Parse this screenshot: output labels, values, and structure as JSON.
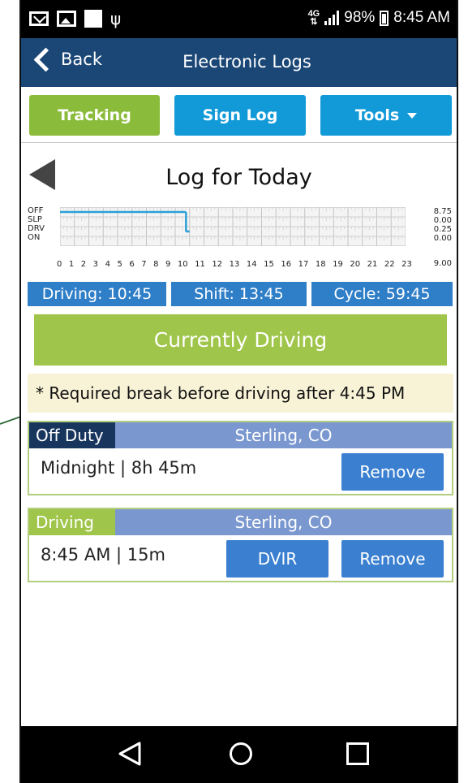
{
  "status_bar": {
    "network": "4G",
    "battery": "98%",
    "time": "8:45 AM"
  },
  "title_bar": {
    "back_label": "Back",
    "title": "Electronic Logs"
  },
  "toolbar": {
    "tracking_label": "Tracking",
    "sign_log_label": "Sign Log",
    "tools_label": "Tools"
  },
  "log": {
    "title": "Log for Today",
    "row_labels": [
      "OFF",
      "SLP",
      "DRV",
      "ON"
    ],
    "row_totals": [
      "8.75",
      "0.00",
      "0.25",
      "0.00"
    ],
    "total": "9.00",
    "hours": [
      "0",
      "1",
      "2",
      "3",
      "4",
      "5",
      "6",
      "7",
      "8",
      "9",
      "10",
      "11",
      "12",
      "13",
      "14",
      "15",
      "16",
      "17",
      "18",
      "19",
      "20",
      "21",
      "22",
      "23"
    ],
    "segments": [
      {
        "status": "OFF",
        "start_hour": 0,
        "end_hour": 8.75
      },
      {
        "status": "DRV",
        "start_hour": 8.75,
        "end_hour": 9.0
      }
    ],
    "line_color": "#2a9fd6"
  },
  "stats": {
    "driving": "Driving: 10:45",
    "shift": "Shift: 13:45",
    "cycle": "Cycle: 59:45"
  },
  "current_status": "Currently Driving",
  "notice": "* Required break before driving after 4:45 PM",
  "entries": [
    {
      "status": "Off Duty",
      "location": "Sterling,  CO",
      "time": "Midnight | 8h 45m",
      "remove_label": "Remove"
    },
    {
      "status": "Driving",
      "location": "Sterling,  CO",
      "time": "8:45 AM | 15m",
      "dvir_label": "DVIR",
      "remove_label": "Remove"
    }
  ],
  "colors": {
    "title_bar": "#1b4776",
    "tracking": "#8bbb3a",
    "primary_blue": "#129ad8",
    "stat_blue": "#2f7ec8",
    "current_green": "#9fc54a",
    "off_duty": "#17355d",
    "entry_header": "#7a98cf"
  }
}
